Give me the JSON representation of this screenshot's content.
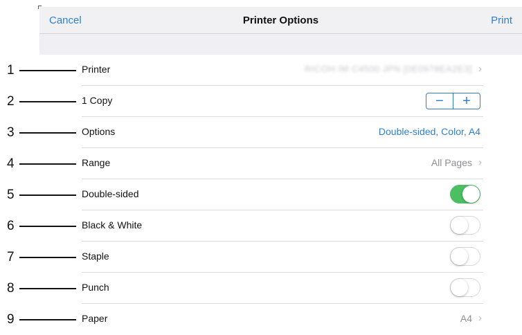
{
  "navbar": {
    "cancel_label": "Cancel",
    "title": "Printer Options",
    "print_label": "Print"
  },
  "accent_color": "#2f7fd0",
  "toggle_on_color": "#4cbf63",
  "callouts": [
    "1",
    "2",
    "3",
    "4",
    "5",
    "6",
    "7",
    "8",
    "9"
  ],
  "rows": {
    "printer": {
      "label": "Printer",
      "value": "RICOH IM C4500 JPN [0E0978EA2E3] ",
      "value_note": "blurred"
    },
    "copies": {
      "label": "1 Copy",
      "minus": "−",
      "plus": "+"
    },
    "options": {
      "label": "Options",
      "value": "Double-sided, Color, A4"
    },
    "range": {
      "label": "Range",
      "value": "All Pages"
    },
    "double_sided": {
      "label": "Double-sided",
      "on": true
    },
    "black_white": {
      "label": "Black & White",
      "on": false
    },
    "staple": {
      "label": "Staple",
      "on": false
    },
    "punch": {
      "label": "Punch",
      "on": false
    },
    "paper": {
      "label": "Paper",
      "value": "A4"
    }
  }
}
